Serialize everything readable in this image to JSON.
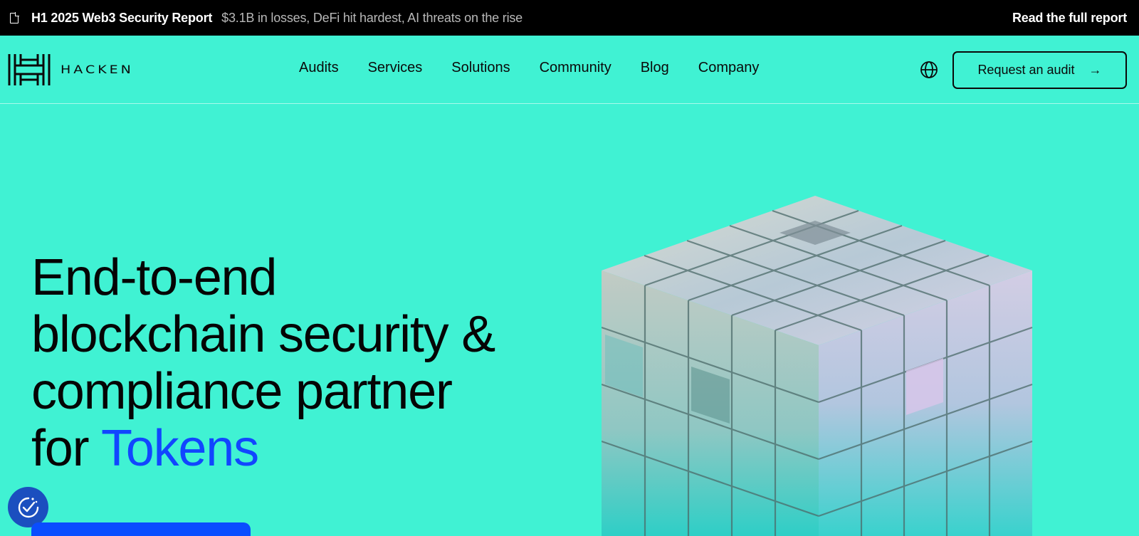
{
  "announcement": {
    "title": "H1 2025 Web3 Security Report",
    "subtitle": "$3.1B in losses, DeFi hit hardest, AI threats on the rise",
    "link": "Read the full report",
    "icon": "document-icon"
  },
  "nav": {
    "logo_text": "HACKEN",
    "items": [
      "Audits",
      "Services",
      "Solutions",
      "Community",
      "Blog",
      "Company"
    ],
    "language_icon": "globe-icon",
    "cta_label": "Request an audit",
    "cta_icon": "arrow-right-icon"
  },
  "hero": {
    "title_lines": [
      "End-to-end",
      "blockchain security &",
      "compliance partner"
    ],
    "title_prefix": "for",
    "title_accent": "Tokens"
  },
  "widgets": {
    "consent_icon": "cookie-consent-icon"
  },
  "colors": {
    "background": "#40f2d3",
    "topbar": "#000000",
    "accent": "#1146ff",
    "text": "#0a0a0a"
  }
}
